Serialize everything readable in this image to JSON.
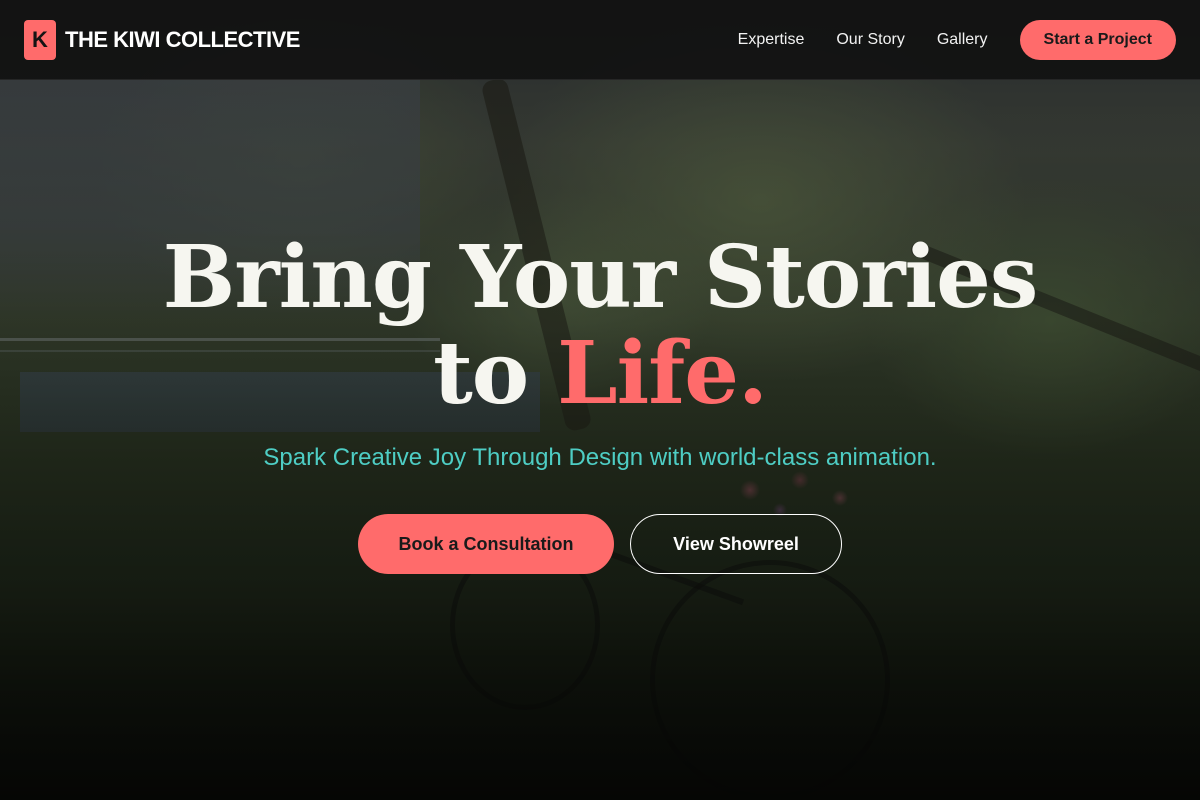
{
  "brand": {
    "logo_letter": "K",
    "name": "THE KIWI COLLECTIVE"
  },
  "nav": {
    "links": [
      "Expertise",
      "Our Story",
      "Gallery"
    ],
    "cta": "Start a Project"
  },
  "hero": {
    "headline_line1": "Bring Your Stories",
    "headline_line2_prefix": "to ",
    "headline_accent": "Life.",
    "subheadline": "Spark Creative Joy Through Design with world-class animation.",
    "primary_button": "Book a Consultation",
    "secondary_button": "View Showreel"
  },
  "colors": {
    "accent": "#ff6b6b",
    "teal": "#4ecdc4",
    "nav_bg": "#121212",
    "headline": "#f6f6f0"
  }
}
